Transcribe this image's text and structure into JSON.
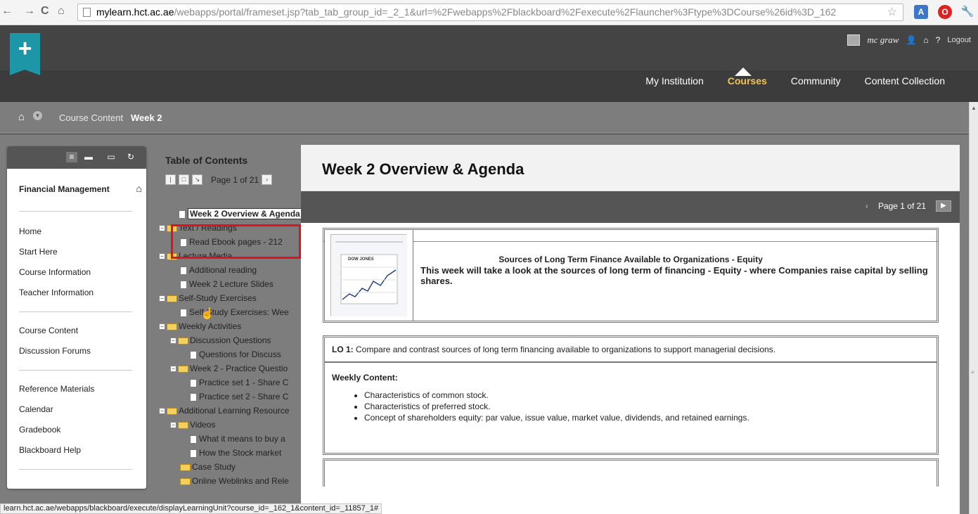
{
  "browser": {
    "url_host": "mylearn.hct.ac.ae",
    "url_path": "/webapps/portal/frameset.jsp?tab_tab_group_id=_2_1&url=%2Fwebapps%2Fblackboard%2Fexecute%2Flauncher%3Ftype%3DCourse%26id%3D_162"
  },
  "header": {
    "username": "mc graw",
    "logout_label": "Logout",
    "tabs": [
      "My Institution",
      "Courses",
      "Community",
      "Content Collection"
    ],
    "active_tab": "Courses"
  },
  "breadcrumb": {
    "items": [
      "Course Content",
      "Week 2"
    ]
  },
  "course_menu": {
    "title": "Financial Management",
    "group1": [
      "Home",
      "Start Here",
      "Course Information",
      "Teacher Information"
    ],
    "group2": [
      "Course Content",
      "Discussion Forums"
    ],
    "group3": [
      "Reference Materials",
      "Calendar",
      "Gradebook",
      "Blackboard Help"
    ]
  },
  "toc": {
    "title": "Table of Contents",
    "pager": "Page 1 of 21",
    "items": [
      "Week 2 Overview & Agenda",
      "Text / Readings",
      "Read Ebook pages - 212",
      "Lecture Media",
      "Additional reading",
      "Week 2 Lecture Slides",
      "Self-Study Exercises",
      "Self-Study Exercises: Wee",
      "Weekly Activities",
      "Discussion Questions",
      "Questions for Discuss",
      "Week 2 - Practice Questio",
      "Practice set 1 - Share C",
      "Practice set 2 - Share C",
      "Additional Learning Resource",
      "Videos",
      "What it means to buy a",
      "How the Stock market",
      "Case Study",
      "Online Weblinks and Rele"
    ]
  },
  "main": {
    "title": "Week 2 Overview & Agenda",
    "pager": "Page 1 of 21",
    "subheading": "Sources of Long Term Finance Available to Organizations - Equity",
    "intro": "This week will take a look at the sources of long term of financing - Equity - where Companies raise capital by selling shares.",
    "image_caption": "DOW JONES",
    "lo_label": "LO 1:",
    "lo_text": " Compare and contrast sources of long term financing available to organizations to support managerial decisions.",
    "weekly_heading": "Weekly Content:",
    "weekly_items": [
      "Characteristics of common stock.",
      "Characteristics of preferred stock.",
      "Concept of shareholders equity: par value, issue value, market value, dividends, and retained earnings."
    ]
  },
  "status_bar": "learn.hct.ac.ae/webapps/blackboard/execute/displayLearningUnit?course_id=_162_1&content_id=_11857_1#"
}
